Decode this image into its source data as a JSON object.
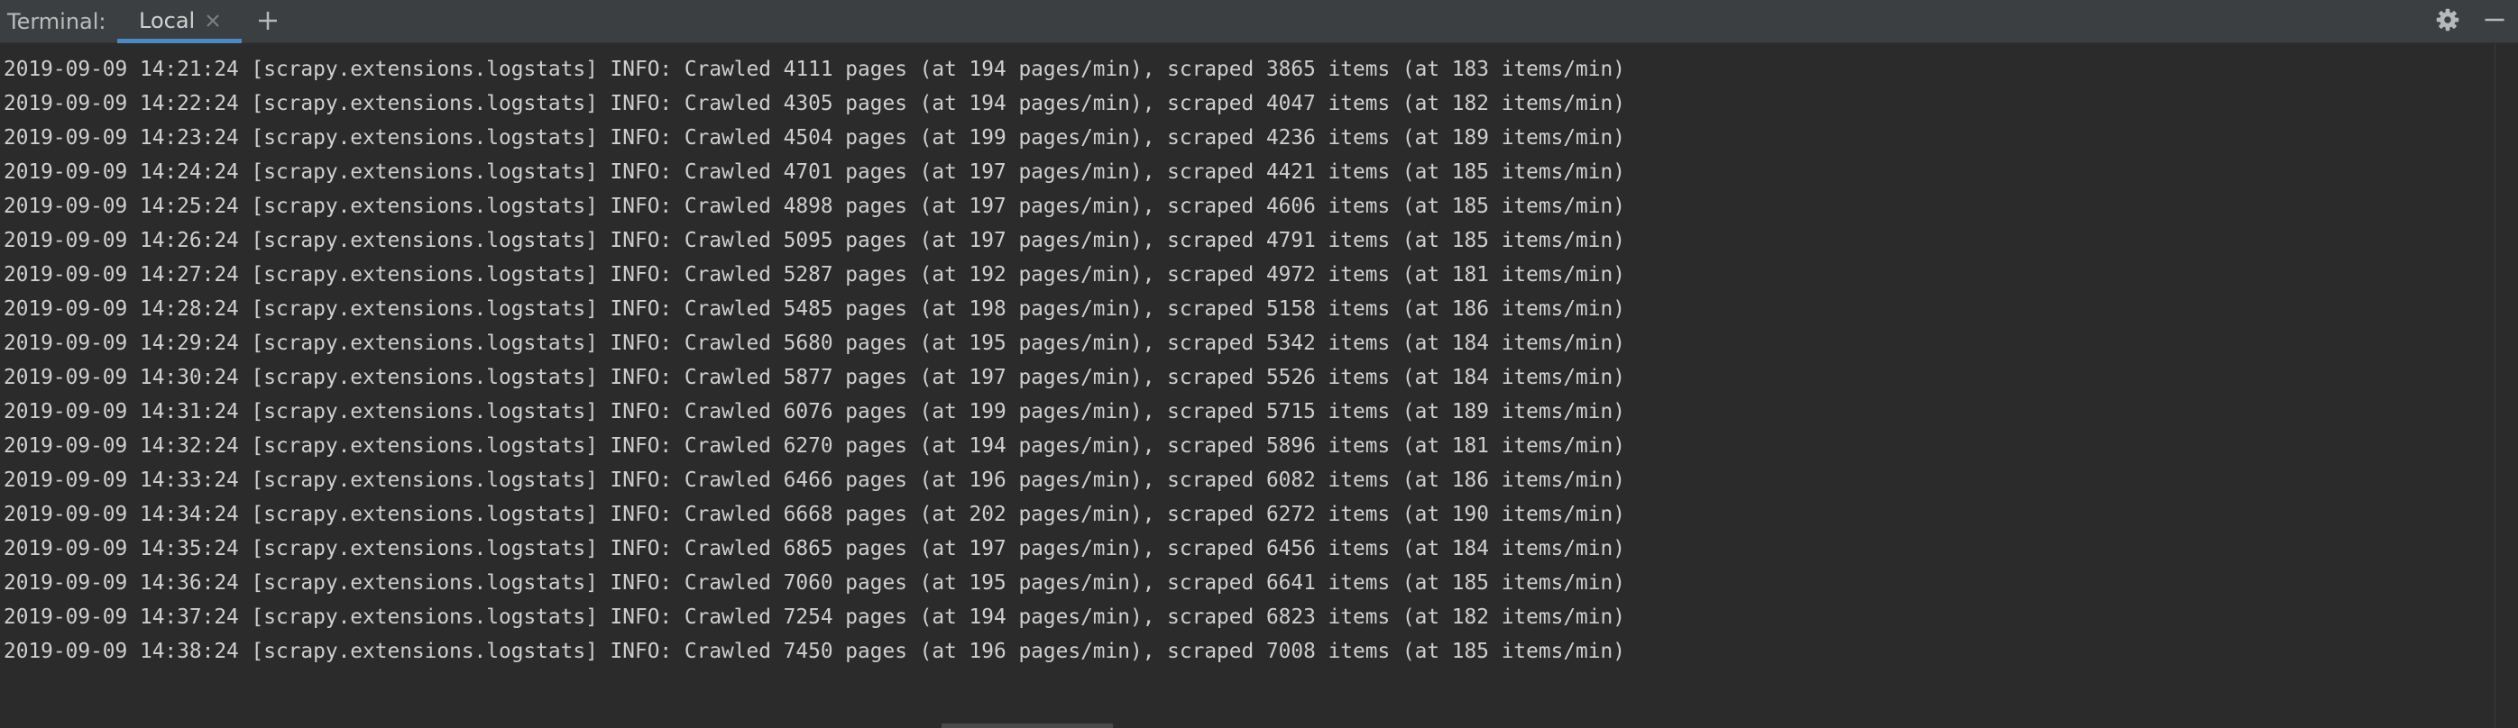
{
  "tabbar": {
    "label": "Terminal:",
    "tabs": [
      {
        "label": "Local"
      }
    ]
  },
  "icons": {
    "close": "close-icon",
    "add": "plus-icon",
    "settings": "gear-icon",
    "minimize": "minimize-icon"
  },
  "colors": {
    "background": "#2b2b2b",
    "tabbar": "#3c3f41",
    "accent": "#4a88c7",
    "text": "#cfcfcf"
  },
  "terminal": {
    "lines": [
      "2019-09-09 14:21:24 [scrapy.extensions.logstats] INFO: Crawled 4111 pages (at 194 pages/min), scraped 3865 items (at 183 items/min)",
      "2019-09-09 14:22:24 [scrapy.extensions.logstats] INFO: Crawled 4305 pages (at 194 pages/min), scraped 4047 items (at 182 items/min)",
      "2019-09-09 14:23:24 [scrapy.extensions.logstats] INFO: Crawled 4504 pages (at 199 pages/min), scraped 4236 items (at 189 items/min)",
      "2019-09-09 14:24:24 [scrapy.extensions.logstats] INFO: Crawled 4701 pages (at 197 pages/min), scraped 4421 items (at 185 items/min)",
      "2019-09-09 14:25:24 [scrapy.extensions.logstats] INFO: Crawled 4898 pages (at 197 pages/min), scraped 4606 items (at 185 items/min)",
      "2019-09-09 14:26:24 [scrapy.extensions.logstats] INFO: Crawled 5095 pages (at 197 pages/min), scraped 4791 items (at 185 items/min)",
      "2019-09-09 14:27:24 [scrapy.extensions.logstats] INFO: Crawled 5287 pages (at 192 pages/min), scraped 4972 items (at 181 items/min)",
      "2019-09-09 14:28:24 [scrapy.extensions.logstats] INFO: Crawled 5485 pages (at 198 pages/min), scraped 5158 items (at 186 items/min)",
      "2019-09-09 14:29:24 [scrapy.extensions.logstats] INFO: Crawled 5680 pages (at 195 pages/min), scraped 5342 items (at 184 items/min)",
      "2019-09-09 14:30:24 [scrapy.extensions.logstats] INFO: Crawled 5877 pages (at 197 pages/min), scraped 5526 items (at 184 items/min)",
      "2019-09-09 14:31:24 [scrapy.extensions.logstats] INFO: Crawled 6076 pages (at 199 pages/min), scraped 5715 items (at 189 items/min)",
      "2019-09-09 14:32:24 [scrapy.extensions.logstats] INFO: Crawled 6270 pages (at 194 pages/min), scraped 5896 items (at 181 items/min)",
      "2019-09-09 14:33:24 [scrapy.extensions.logstats] INFO: Crawled 6466 pages (at 196 pages/min), scraped 6082 items (at 186 items/min)",
      "2019-09-09 14:34:24 [scrapy.extensions.logstats] INFO: Crawled 6668 pages (at 202 pages/min), scraped 6272 items (at 190 items/min)",
      "2019-09-09 14:35:24 [scrapy.extensions.logstats] INFO: Crawled 6865 pages (at 197 pages/min), scraped 6456 items (at 184 items/min)",
      "2019-09-09 14:36:24 [scrapy.extensions.logstats] INFO: Crawled 7060 pages (at 195 pages/min), scraped 6641 items (at 185 items/min)",
      "2019-09-09 14:37:24 [scrapy.extensions.logstats] INFO: Crawled 7254 pages (at 194 pages/min), scraped 6823 items (at 182 items/min)",
      "2019-09-09 14:38:24 [scrapy.extensions.logstats] INFO: Crawled 7450 pages (at 196 pages/min), scraped 7008 items (at 185 items/min)"
    ]
  }
}
